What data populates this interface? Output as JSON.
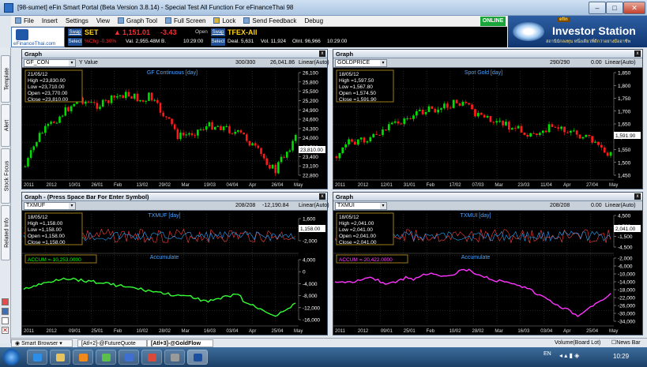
{
  "window": {
    "title": "[98-sumet] eFin Smart Portal (Beta Version 3.8.14) - Special Test All Function For eFinanceThai  98"
  },
  "menu": {
    "file": "File",
    "insert": "Insert",
    "settings": "Settings",
    "view": "View",
    "graph_tool": "Graph Tool",
    "full_screen": "Full Screen",
    "lock": "Lock",
    "send_feedback": "Send Feedback",
    "debug": "Debug",
    "online": "ONLINE"
  },
  "quote": {
    "logo_text": "eFinanceThai.com",
    "swap_label": "Swap",
    "select_label": "Select",
    "set_symbol": "SET",
    "set_value": "1,151.01",
    "set_change": "-3.43",
    "set_pct": "%Chg -0.30%",
    "set_val": "Val. 2,955.48M B.",
    "set_time": "10:29:00",
    "open_label": "Open",
    "tfex_symbol": "TFEX-All",
    "tfex_deal": "Deal. 5,631",
    "tfex_vol": "Vol. 11,924",
    "tfex_oint": "OInt. 96,966",
    "tfex_time": "10:29:00"
  },
  "ad": {
    "brand": "efin",
    "title": "Investor Station",
    "thai": "สถานีนักลงทุน หนึ่งเดียวที่ดีกว่าอย่างมืออาชีพ"
  },
  "sidetabs": {
    "template": "Template",
    "alert": "Alert",
    "stock_focus": "Stock Focus",
    "related_info": "Related Info"
  },
  "panels": {
    "p1": {
      "header": "Graph",
      "symbol": "GF_CON",
      "mode": "Y Value",
      "count": "300/300",
      "last": "26,041.86",
      "scale": "Linear(Auto)",
      "series_title": "GF Continuous [day]",
      "info_date": "21/05/12",
      "info_high": "High  =23,830.00",
      "info_low": "Low  =23,710.00",
      "info_open": "Open  =23,770.00",
      "info_close": "Close  =23,810.00",
      "price_tag": "23,810.00",
      "ylabels": [
        "26,100",
        "25,800",
        "25,500",
        "25,200",
        "24,900",
        "24,600",
        "24,300",
        "24,000",
        "23,700",
        "23,400",
        "23,100",
        "22,800"
      ],
      "xlabels": [
        "2011",
        "2012",
        "10/01",
        "26/01",
        "Feb",
        "13/02",
        "29/02",
        "Mar",
        "19/03",
        "04/04",
        "Apr",
        "26/04",
        "May"
      ]
    },
    "p2": {
      "header": "Graph",
      "symbol": "GOLDPRICE",
      "count": "290/290",
      "last": "0.00",
      "scale": "Linear(Auto)",
      "series_title": "Spot Gold [day]",
      "info_date": "18/05/12",
      "info_high": "High  =1,597.50",
      "info_low": "Low  =1,567.80",
      "info_open": "Open  =1,574.50",
      "info_close": "Close  =1,591.90",
      "price_tag": "1,591.90",
      "ylabels": [
        "1,850",
        "1,800",
        "1,750",
        "1,700",
        "1,650",
        "1,600",
        "1,550",
        "1,500",
        "1,450"
      ],
      "xlabels": [
        "2011",
        "2012",
        "12/01",
        "31/01",
        "Feb",
        "17/02",
        "07/03",
        "Mar",
        "23/03",
        "11/04",
        "Apr",
        "27/04",
        "May"
      ]
    },
    "p3": {
      "header": "Graph  -  (Press Space Bar For Enter Symbol)",
      "symbol": "TXMUF",
      "count": "208/208",
      "last": "-12,190.84",
      "scale": "Linear(Auto)",
      "series_title": "TXMUF [day]",
      "info_date": "18/05/12",
      "info_high": "High  =1,158.00",
      "info_low": "Low  =1,158.00",
      "info_open": "Open  =1,158.00",
      "info_close": "Close  =1,158.00",
      "price_tag": "1,158.00",
      "ylabels_top": [
        "1,600",
        "0",
        "-2,000"
      ],
      "accum_title": "Accumulate",
      "accum_label": "ACCUM  =-10,253.0000",
      "ylabels_bottom": [
        "4,000",
        "0",
        "-4,000",
        "-8,000",
        "-12,000",
        "-16,000"
      ],
      "xlabels": [
        "2011",
        "2012",
        "09/01",
        "25/01",
        "Feb",
        "10/02",
        "28/02",
        "Mar",
        "16/03",
        "03/04",
        "Apr",
        "25/04",
        "May"
      ]
    },
    "p4": {
      "header": "Graph",
      "symbol": "TXMUI",
      "count": "208/208",
      "last": "0.00",
      "scale": "Linear(Auto)",
      "series_title": "TXMUI [day]",
      "info_date": "18/05/12",
      "info_high": "High  =2,041.00",
      "info_low": "Low  =2,041.00",
      "info_open": "Open  =2,041.00",
      "info_close": "Close  =2,041.00",
      "price_tag": "2,041.00",
      "ylabels_top": [
        "4,500",
        "1,500",
        "-1,500",
        "-4,500"
      ],
      "accum_title": "Accumulate",
      "accum_label": "ACCUM  =-20,422.0000",
      "ylabels_bottom": [
        "-2,000",
        "-6,000",
        "-10,000",
        "-14,000",
        "-18,000",
        "-22,000",
        "-26,000",
        "-30,000",
        "-34,000"
      ],
      "xlabels": [
        "2011",
        "2012",
        "09/01",
        "25/01",
        "Feb",
        "10/02",
        "28/02",
        "Mar",
        "16/03",
        "03/04",
        "Apr",
        "25/04",
        "May"
      ]
    }
  },
  "bottom_tabs": {
    "smart_browser": "Smart Browser",
    "tab1": "[Atl+2]-@FutureQuote",
    "tab2": "[Atl+3]-@GoldFlow",
    "volume": "Volume(Board Lot)",
    "news": "News Bar"
  },
  "taskbar": {
    "lang": "EN",
    "clock": "10:29"
  }
}
